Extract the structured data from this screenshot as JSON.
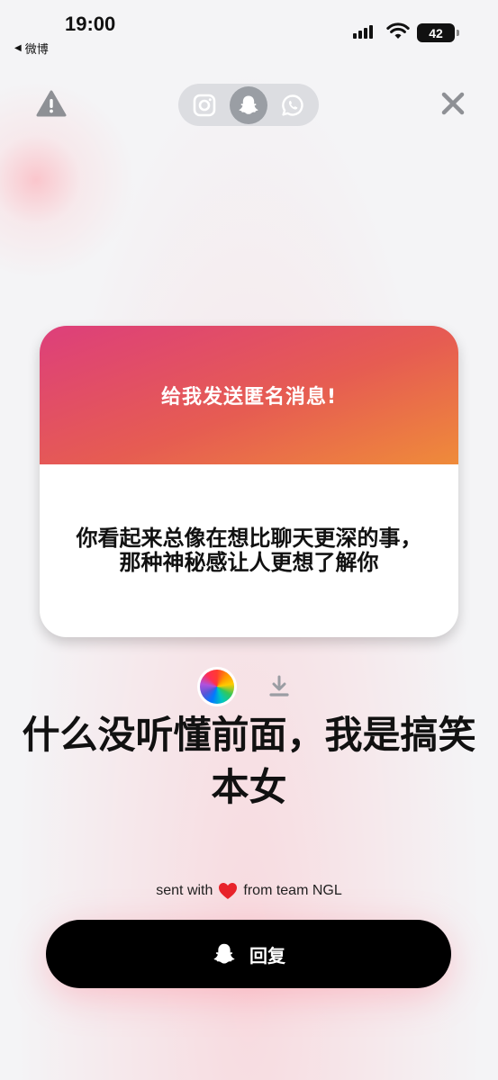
{
  "status_bar": {
    "time": "19:00",
    "back_app": "微博",
    "battery": "42"
  },
  "top": {
    "icons": [
      "warning-icon",
      "instagram-icon",
      "snapchat-icon",
      "whatsapp-icon",
      "close-icon"
    ],
    "active_share": "snapchat"
  },
  "card": {
    "title": "给我发送匿名消息!",
    "question": "你看起来总像在想比聊天更深的事，那种神秘感让人更想了解你",
    "header_colors": [
      "#dd3f7b",
      "#e65c52",
      "#ef8b3a"
    ]
  },
  "answer": "什么没听懂前面，我是搞笑本女",
  "footer": {
    "sent_prefix": "sent with",
    "sent_suffix": "from team NGL",
    "reply_label": "回复"
  }
}
